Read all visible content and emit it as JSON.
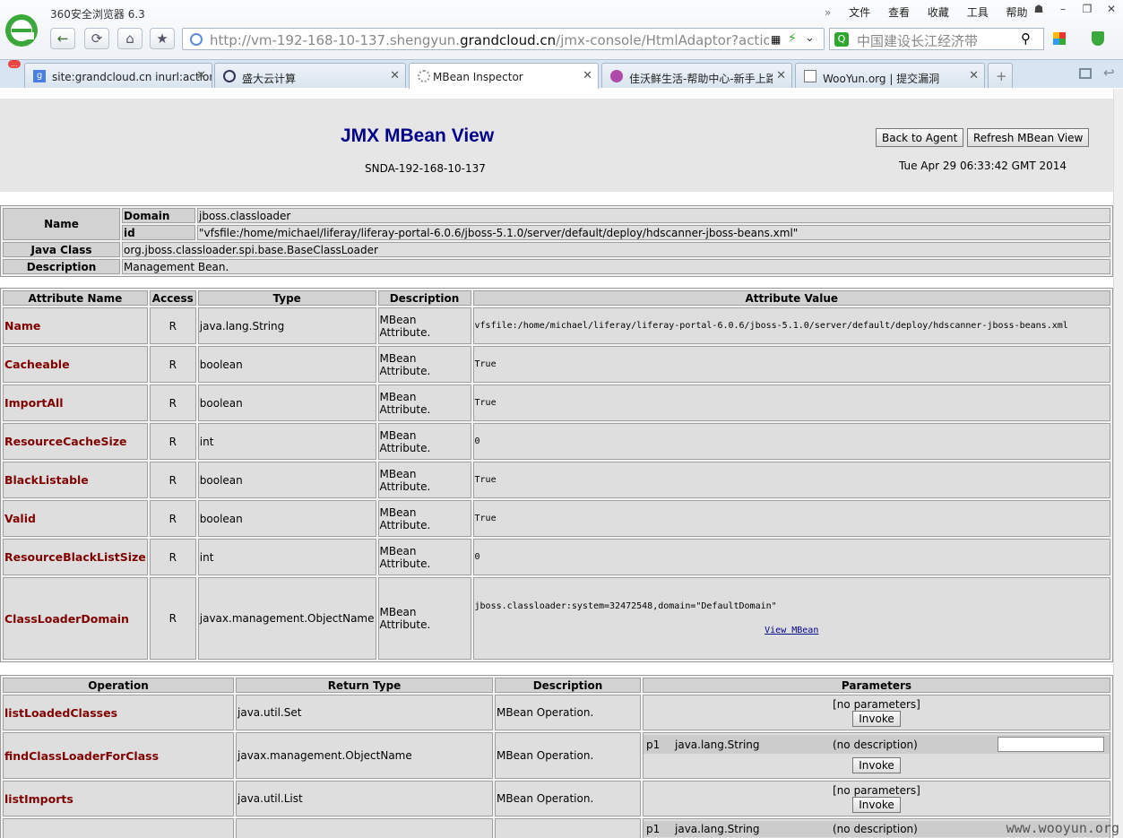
{
  "browser": {
    "title": "360安全浏览器 6.3",
    "menu": [
      "文件",
      "查看",
      "收藏",
      "工具",
      "帮助"
    ],
    "url_pre": "http://vm-192-168-10-137.shengyun.",
    "url_domain": "grandcloud.cn",
    "url_post": "/jmx-console/HtmlAdaptor?action=inspectM",
    "search_text": "中国建设长江经济带",
    "tabs": [
      "site:grandcloud.cn inurl:action - G",
      "盛大云计算",
      "MBean Inspector",
      "佳沃鲜生活-帮助中心-新手上路",
      "WooYun.org | 提交漏洞"
    ],
    "badge": "..."
  },
  "page": {
    "title": "JMX MBean View",
    "host": "SNDA-192-168-10-137",
    "date": "Tue Apr 29 06:33:42 GMT 2014",
    "back_btn": "Back to Agent",
    "refresh_btn": "Refresh MBean View"
  },
  "info": {
    "name_label": "Name",
    "domain_label": "Domain",
    "domain": "jboss.classloader",
    "id_label": "id",
    "id": "\"vfsfile:/home/michael/liferay/liferay-portal-6.0.6/jboss-5.1.0/server/default/deploy/hdscanner-jboss-beans.xml\"",
    "class_label": "Java Class",
    "class": "org.jboss.classloader.spi.base.BaseClassLoader",
    "desc_label": "Description",
    "desc": "Management Bean."
  },
  "attr_headers": [
    "Attribute Name",
    "Access",
    "Type",
    "Description",
    "Attribute Value"
  ],
  "attributes": [
    {
      "name": "Name",
      "access": "R",
      "type": "java.lang.String",
      "desc": "MBean Attribute.",
      "value": "vfsfile:/home/michael/liferay/liferay-portal-6.0.6/jboss-5.1.0/server/default/deploy/hdscanner-jboss-beans.xml"
    },
    {
      "name": "Cacheable",
      "access": "R",
      "type": "boolean",
      "desc": "MBean Attribute.",
      "value": "True"
    },
    {
      "name": "ImportAll",
      "access": "R",
      "type": "boolean",
      "desc": "MBean Attribute.",
      "value": "True"
    },
    {
      "name": "ResourceCacheSize",
      "access": "R",
      "type": "int",
      "desc": "MBean Attribute.",
      "value": "0"
    },
    {
      "name": "BlackListable",
      "access": "R",
      "type": "boolean",
      "desc": "MBean Attribute.",
      "value": "True"
    },
    {
      "name": "Valid",
      "access": "R",
      "type": "boolean",
      "desc": "MBean Attribute.",
      "value": "True"
    },
    {
      "name": "ResourceBlackListSize",
      "access": "R",
      "type": "int",
      "desc": "MBean Attribute.",
      "value": "0"
    },
    {
      "name": "ClassLoaderDomain",
      "access": "R",
      "type": "javax.management.ObjectName",
      "desc": "MBean Attribute.",
      "value": "jboss.classloader:system=32472548,domain=\"DefaultDomain\"",
      "link": "View MBean"
    }
  ],
  "op_headers": [
    "Operation",
    "Return Type",
    "Description",
    "Parameters"
  ],
  "operations": [
    {
      "name": "listLoadedClasses",
      "ret": "java.util.Set",
      "desc": "MBean Operation.",
      "params": "[no parameters]",
      "invoke": "Invoke"
    },
    {
      "name": "findClassLoaderForClass",
      "ret": "javax.management.ObjectName",
      "desc": "MBean Operation.",
      "p_name": "p1",
      "p_type": "java.lang.String",
      "p_desc": "(no description)",
      "invoke": "Invoke"
    },
    {
      "name": "listImports",
      "ret": "java.util.List",
      "desc": "MBean Operation.",
      "params": "[no parameters]",
      "invoke": "Invoke"
    },
    {
      "name": "",
      "ret": "",
      "desc": "",
      "p_name": "p1",
      "p_type": "java.lang.String",
      "p_desc": "(no description)"
    }
  ],
  "watermark": "www.wooyun.org"
}
